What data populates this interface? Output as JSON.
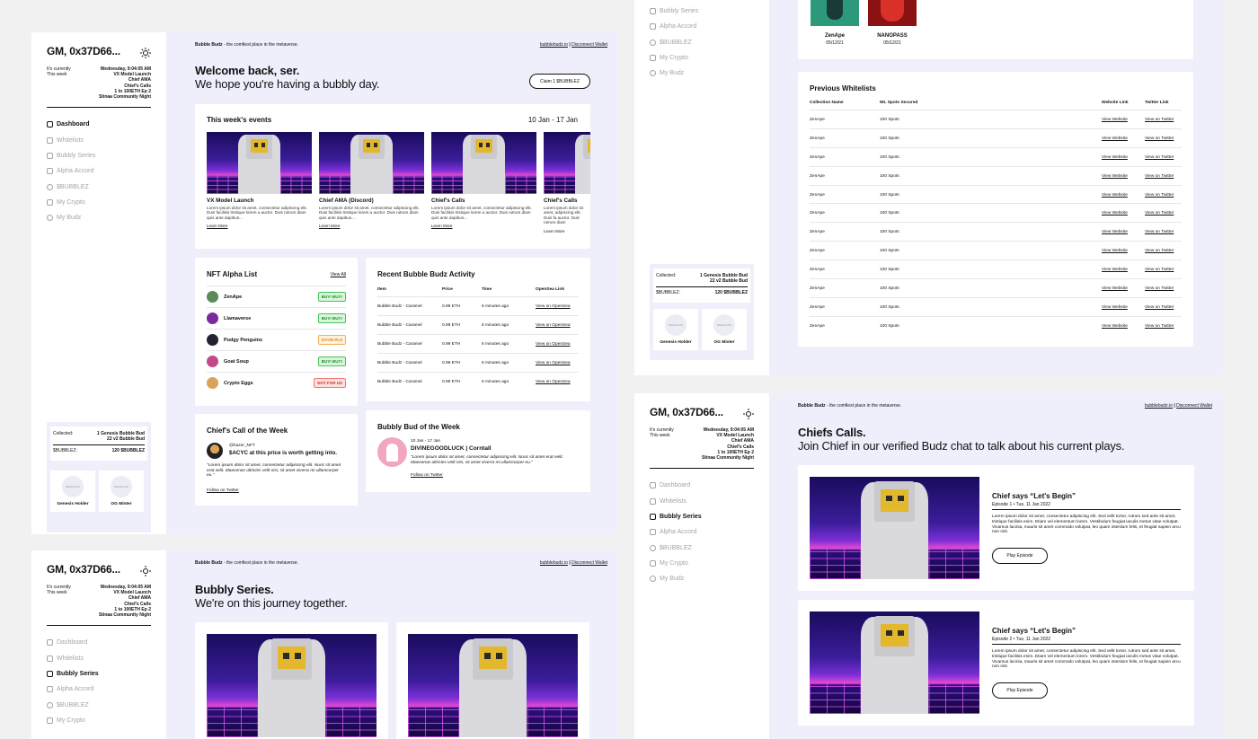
{
  "wallet": {
    "greeting": "GM, 0x37D66...",
    "currently_label": "It's currently",
    "currently_value": "Wednesday, 9:04:05 AM",
    "thisweek_label": "This week",
    "thisweek_items": [
      "VX Model Launch",
      "Chief AMA",
      "Chief's Calls",
      "1 to 100ETH Ep 2",
      "Stinaa Community Night"
    ]
  },
  "nav": [
    "Dashboard",
    "Whitelists",
    "Bubbly Series",
    "Alpha Accord",
    "$BUBBLEZ",
    "My Crypto",
    "My Budz"
  ],
  "topbar": {
    "tagline_brand": "Bubble Budz",
    "tagline_rest": " - the comfiest place in the metaverse.",
    "link_site": "bubblebudz.io",
    "sep": "|",
    "link_disconnect": "Disconnect Wallet"
  },
  "dashboard": {
    "welcome": "Welcome back, ser.",
    "sub": "We hope you're having a bubbly day.",
    "claim": "Claim 1 $BUBBLEZ",
    "events_title": "This week's events",
    "events_range": "10 Jan - 17 Jan",
    "events": [
      {
        "title": "VX Model Launch",
        "desc": "Lorem ipsum dolor sit amet, consectetur adipiscing elit. Duis facilisis tristique lorem a auctor. Duis rutrum diam quis ante dapibus...",
        "link": "Learn More"
      },
      {
        "title": "Chief AMA (Discord)",
        "desc": "Lorem ipsum dolor sit amet, consectetur adipiscing elit. Duis facilisis tristique lorem a auctor. Duis rutrum diam quis ante dapibus...",
        "link": "Learn More"
      },
      {
        "title": "Chief's Calls",
        "desc": "Lorem ipsum dolor sit amet, consectetur adipiscing elit. Duis facilisis tristique lorem a auctor. Duis rutrum diam quis ante dapibus...",
        "link": "Learn More"
      },
      {
        "title": "Chief's Calls",
        "desc": "Lorem ipsum dolor sit amet, adipiscing elit. Duis fa auctor. Duis rutrum diam",
        "link": "Learn More"
      }
    ],
    "alpha_title": "NFT Alpha List",
    "alpha_viewall": "View All",
    "alpha": [
      {
        "name": "ZenApe",
        "badge": "BUY! BUY!",
        "kind": "green",
        "color": "#5a8a5a"
      },
      {
        "name": "Llamaverse",
        "badge": "BUY! BUY!",
        "kind": "green",
        "color": "#7a2a9a"
      },
      {
        "name": "Pudgy Penguins",
        "badge": "DYOR PLS",
        "kind": "orange",
        "color": "#222233"
      },
      {
        "name": "Goat Soup",
        "badge": "BUY! BUY!",
        "kind": "green",
        "color": "#c24a8a"
      },
      {
        "name": "Crypto Eggs",
        "badge": "NOT FOR US",
        "kind": "red",
        "color": "#d9a35a"
      }
    ],
    "activity_title": "Recent Bubble Budz Activity",
    "activity_headers": [
      "Item",
      "Price",
      "Time",
      "OpenSea Link"
    ],
    "activity_rows": [
      [
        "Bubble Budz - Caramel",
        "0.99 ETH",
        "6 minutes ago",
        "View on OpenSea"
      ],
      [
        "Bubble Budz - Caramel",
        "0.99 ETH",
        "6 minutes ago",
        "View on OpenSea"
      ],
      [
        "Bubble Budz - Caramel",
        "0.99 ETH",
        "6 minutes ago",
        "View on OpenSea"
      ],
      [
        "Bubble Budz - Caramel",
        "0.99 ETH",
        "6 minutes ago",
        "View on OpenSea"
      ],
      [
        "Bubble Budz - Caramel",
        "0.99 ETH",
        "6 minutes ago",
        "View on OpenSea"
      ]
    ],
    "chief_title": "Chief's Call of the Week",
    "chief_handle": "@hazer_NFT",
    "chief_quote": "$ACYC at this price is worth getting into.",
    "chief_body": "\"Lorem ipsum dolor sit amet, consectetur adipiscing elit. Nunc sit amet erat velit. Maecenas ultricies velit nisi, sit amet viverra mi ullamcorper eu.\"",
    "chief_link": "Follow on Twitter",
    "bud_title": "Bubbly Bud of the Week",
    "bud_range": "10 Jan - 17 Jan",
    "bud_name": "DIVINEGOODLUCK | Corntall",
    "bud_body": "\"Lorem ipsum dolor sit amet, consectetur adipiscing elit. Nunc sit amet erat velit. Maecenas ultricies velit nisi, sit amet viverra mi ullamcorper eu.\"",
    "bud_link": "Follow on Twitter"
  },
  "collected": {
    "label1": "Collected:",
    "value1a": "1 Genesis Bubble Bud",
    "value1b": "22 v2 Bubble Bud",
    "label2": "$BUBBLEZ:",
    "value2": "120 $BUBBLEZ",
    "badge_a": "Genesis Holder",
    "badge_b": "OG Minter",
    "placeholder": "BADGE ICON"
  },
  "series": {
    "title": "Bubbly Series.",
    "sub": "We're on this journey together."
  },
  "whitelist": {
    "nft_a": "ZenApe",
    "date_a": "05/12/21",
    "nft_b": "NANOPASS",
    "date_b": "05/12/21",
    "title": "Previous Whitelists",
    "headers": [
      "Collection Name",
      "WL Spots Secured",
      "Website Link",
      "Twitter Link"
    ],
    "rows": [
      [
        "ZenApe",
        "100 Spots",
        "View Website",
        "View on Twitter"
      ],
      [
        "ZenApe",
        "100 Spots",
        "View Website",
        "View on Twitter"
      ],
      [
        "ZenApe",
        "100 Spots",
        "View Website",
        "View on Twitter"
      ],
      [
        "ZenApe",
        "100 Spots",
        "View Website",
        "View on Twitter"
      ],
      [
        "ZenApe",
        "100 Spots",
        "View Website",
        "View on Twitter"
      ],
      [
        "ZenApe",
        "100 Spots",
        "View Website",
        "View on Twitter"
      ],
      [
        "ZenApe",
        "100 Spots",
        "View Website",
        "View on Twitter"
      ],
      [
        "ZenApe",
        "100 Spots",
        "View Website",
        "View on Twitter"
      ],
      [
        "ZenApe",
        "100 Spots",
        "View Website",
        "View on Twitter"
      ],
      [
        "ZenApe",
        "100 Spots",
        "View Website",
        "View on Twitter"
      ],
      [
        "ZenApe",
        "100 Spots",
        "View Website",
        "View on Twitter"
      ],
      [
        "ZenApe",
        "100 Spots",
        "View Website",
        "View on Twitter"
      ]
    ]
  },
  "calls": {
    "title": "Chiefs Calls.",
    "sub": "Join Chief in our verified Budz chat to talk about his current plays.",
    "episodes": [
      {
        "title": "Chief says “Let's Begin”",
        "meta": "Episode 1 • Tue, 11 Jan 2022",
        "body": "Lorem ipsum dolor sit amet, consectetur adipiscing elit. Sed velit tortor, rutrum sed ante sit amet, tristique facilisis enim. Etiam vel elementum lorem. Vestibulum feugiat iaculis metus vitae volutpat. Vivamus lacinia, mauris sit amet commodo volutpat, leo quam interdum felis, et feugiat sapien arcu non nisl.",
        "play": "Play Episode"
      },
      {
        "title": "Chief says “Let's Begin”",
        "meta": "Episode 2 • Tue, 11 Jan 2022",
        "body": "Lorem ipsum dolor sit amet, consectetur adipiscing elit. Sed velit tortor, rutrum sed ante sit amet, tristique facilisis enim. Etiam vel elementum lorem. Vestibulum feugiat iaculis metus vitae volutpat. Vivamus lacinia, mauris sit amet commodo volutpat, leo quam interdum felis, et feugiat sapien arcu non nisl.",
        "play": "Play Episode"
      }
    ]
  }
}
